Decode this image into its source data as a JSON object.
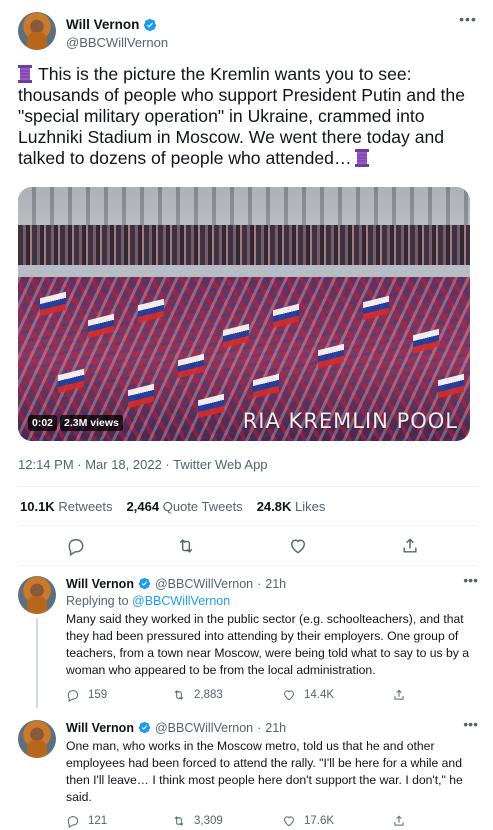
{
  "tweet": {
    "author_name": "Will Vernon",
    "author_handle": "@BBCWillVernon",
    "text": "This is the picture the Kremlin wants you to see: thousands of people who support President Putin and the \"special military operation\" in Ukraine, crammed into Luzhniki Stadium in Moscow. We went there today and talked to dozens of people who attended…",
    "media": {
      "timestamp": "0:02",
      "views": "2.3M views",
      "watermark": "RIA KREMLIN POOL"
    },
    "time": "12:14 PM · Mar 18, 2022 · Twitter Web App",
    "stats": {
      "retweets_value": "10.1K",
      "retweets_label": "Retweets",
      "quotes_value": "2,464",
      "quotes_label": "Quote Tweets",
      "likes_value": "24.8K",
      "likes_label": "Likes"
    }
  },
  "replies": [
    {
      "author_name": "Will Vernon",
      "author_handle": "@BBCWillVernon",
      "dot": "·",
      "time": "21h",
      "replying_prefix": "Replying to",
      "replying_to": "@BBCWillVernon",
      "text": "Many said they worked in the public sector (e.g. schoolteachers), and that they had been pressured into attending by their employers. One group of teachers, from a town near Moscow, were being told what to say to us by a woman who appeared to be from the local administration.",
      "replies_count": "159",
      "retweets_count": "2,883",
      "likes_count": "14.4K"
    },
    {
      "author_name": "Will Vernon",
      "author_handle": "@BBCWillVernon",
      "dot": "·",
      "time": "21h",
      "text": "One man, who works in the Moscow metro, told us that he and other employees had been forced to attend the rally. \"I'll be here for a while and then I'll leave… I think most people here don't support the war. I don't,\" he said.",
      "replies_count": "121",
      "retweets_count": "3,309",
      "likes_count": "17.6K"
    }
  ],
  "colors": {
    "accent": "#1d9bf0",
    "text_primary": "#0f1419",
    "text_secondary": "#536471",
    "divider": "#eff3f4"
  },
  "icons": {
    "verified": "verified-badge-icon",
    "more": "more-horizontal-icon",
    "reply": "reply-icon",
    "retweet": "retweet-icon",
    "like": "heart-icon",
    "share": "share-icon",
    "spool": "spool-of-thread-emoji"
  }
}
